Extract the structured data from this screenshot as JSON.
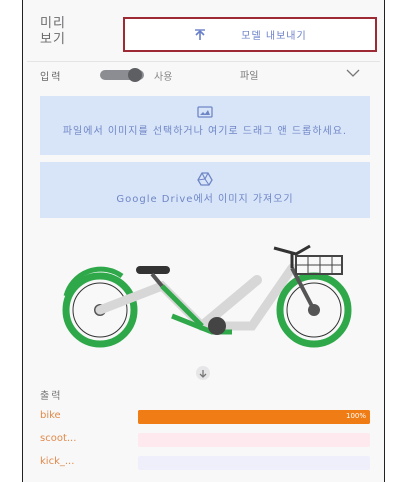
{
  "header": {
    "title": "미리 보기",
    "export_label": "모델 내보내기"
  },
  "input": {
    "label": "입력",
    "option_camera": "사용",
    "select_value": "파일"
  },
  "upload": {
    "text": "파일에서 이미지를 선택하거나 여기로 드래그 앤 드롭하세요."
  },
  "gdrive": {
    "text": "Google Drive에서 이미지 가져오기"
  },
  "output": {
    "label": "출력",
    "results": [
      {
        "label": "bike",
        "value": 1.0,
        "pct_text": "100%",
        "color": "#f07c16",
        "track": "#f07c16"
      },
      {
        "label": "scoot...",
        "value": 0.0,
        "pct_text": "",
        "color": "#fce1e8",
        "track": "#fde9ee"
      },
      {
        "label": "kick_...",
        "value": 0.0,
        "pct_text": "",
        "color": "#eae9fb",
        "track": "#efeffc"
      }
    ]
  }
}
